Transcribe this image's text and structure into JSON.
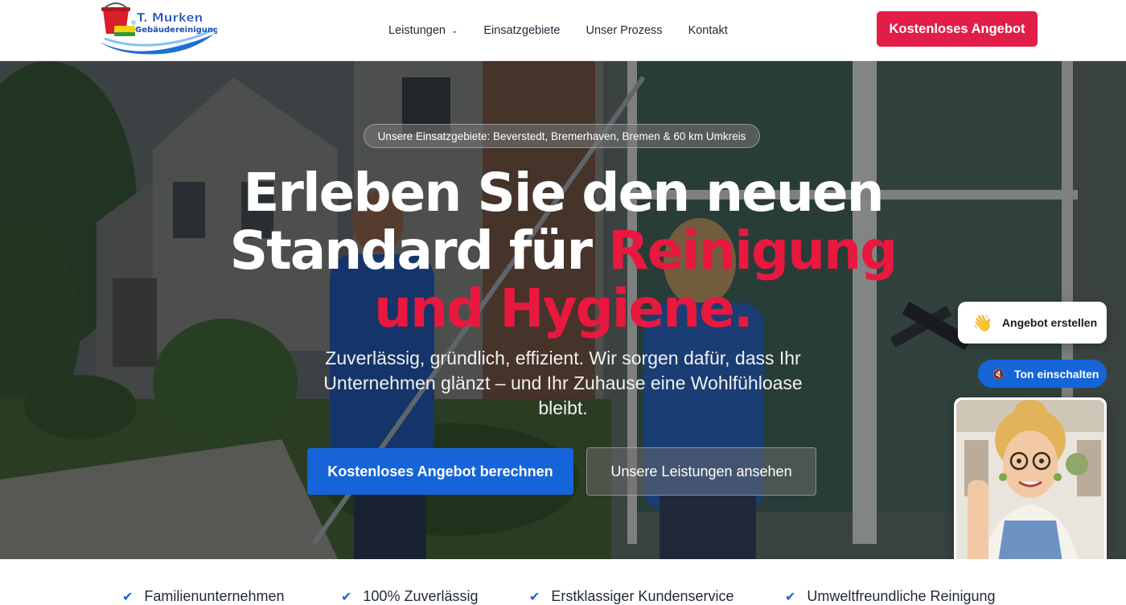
{
  "brand": {
    "name": "T. Murken",
    "subtitle": "Gebäudereinigung"
  },
  "nav": {
    "items": [
      {
        "label": "Leistungen",
        "has_dropdown": true
      },
      {
        "label": "Einsatzgebiete"
      },
      {
        "label": "Unser Prozess"
      },
      {
        "label": "Kontakt"
      }
    ],
    "cta_label": "Kostenloses Angebot"
  },
  "hero": {
    "badge": "Unsere Einsatzgebiete: Beverstedt, Bremerhaven, Bremen & 60 km Umkreis",
    "headline_line1": "Erleben Sie den neuen",
    "headline_line2_white": "Standard für ",
    "headline_line2_accent": "Reinigung",
    "headline_line3_accent": "und Hygiene.",
    "subtext": "Zuverlässig, gründlich, effizient. Wir sorgen dafür, dass Ihr Unternehmen glänzt – und Ihr Zuhause eine Wohlfühloase bleibt.",
    "primary_button": "Kostenloses Angebot berechnen",
    "secondary_button": "Unsere Leistungen ansehen"
  },
  "widget": {
    "offer_label": "Angebot erstellen",
    "offer_icon": "waving-hand-icon",
    "sound_label": "Ton einschalten",
    "sound_icon": "muted-speaker-icon"
  },
  "features": [
    "Familienunternehmen",
    "100% Zuverlässig",
    "Erstklassiger Kundenservice",
    "Umweltfreundliche Reinigung"
  ],
  "colors": {
    "accent_red": "#e11d48",
    "headline_red": "#e8183f",
    "primary_blue": "#1565d8"
  }
}
